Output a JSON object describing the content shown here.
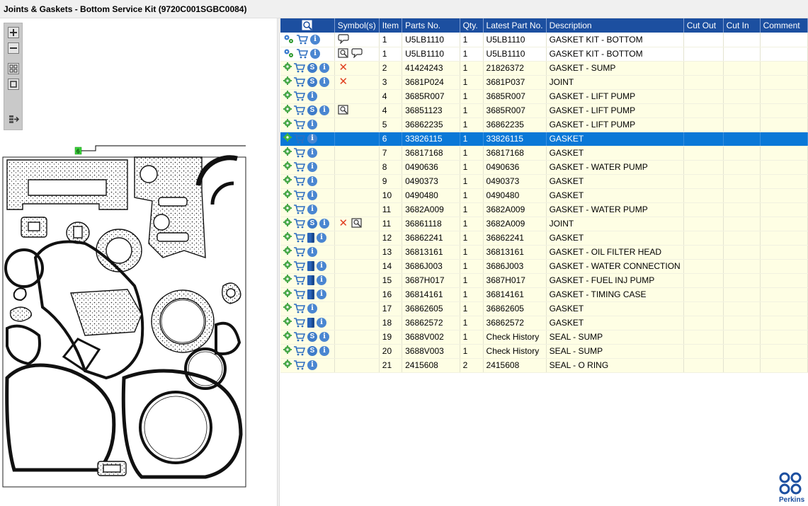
{
  "window": {
    "title": "Joints & Gaskets - Bottom Service Kit (9720C001SGBC0084)"
  },
  "toolbar": {
    "zoom_in": "zoom-in",
    "zoom_out": "zoom-out",
    "fit_page": "fit-page",
    "actual_size": "actual-size",
    "export": "export"
  },
  "drawing": {
    "callout_label": "6"
  },
  "columns": {
    "symbols": "Symbol(s)",
    "item": "Item",
    "parts_no": "Parts No.",
    "qty": "Qty.",
    "latest_part_no": "Latest Part No.",
    "description": "Description",
    "cut_out": "Cut Out",
    "cut_in": "Cut In",
    "comment": "Comment"
  },
  "rows": [
    {
      "item": "1",
      "parts_no": "U5LB1110",
      "qty": "1",
      "latest": "U5LB1110",
      "desc": "GASKET KIT - BOTTOM",
      "style": "white",
      "kit": true,
      "s": false,
      "book": false,
      "sym": [
        "note"
      ]
    },
    {
      "item": "1",
      "parts_no": "U5LB1110",
      "qty": "1",
      "latest": "U5LB1110",
      "desc": "GASKET KIT - BOTTOM",
      "style": "white",
      "kit": true,
      "s": false,
      "book": false,
      "sym": [
        "view",
        "note"
      ]
    },
    {
      "item": "2",
      "parts_no": "41424243",
      "qty": "1",
      "latest": "21826372",
      "desc": "GASKET - SUMP",
      "style": "yellow",
      "kit": false,
      "s": true,
      "book": false,
      "sym": [
        "x"
      ]
    },
    {
      "item": "3",
      "parts_no": "3681P024",
      "qty": "1",
      "latest": "3681P037",
      "desc": "JOINT",
      "style": "yellow",
      "kit": false,
      "s": true,
      "book": false,
      "sym": [
        "x"
      ]
    },
    {
      "item": "4",
      "parts_no": "3685R007",
      "qty": "1",
      "latest": "3685R007",
      "desc": "GASKET - LIFT PUMP",
      "style": "yellow",
      "kit": false,
      "s": false,
      "book": false,
      "sym": []
    },
    {
      "item": "4",
      "parts_no": "36851123",
      "qty": "1",
      "latest": "3685R007",
      "desc": "GASKET - LIFT PUMP",
      "style": "yellow",
      "kit": false,
      "s": true,
      "book": false,
      "sym": [
        "view"
      ]
    },
    {
      "item": "5",
      "parts_no": "36862235",
      "qty": "1",
      "latest": "36862235",
      "desc": "GASKET - LIFT PUMP",
      "style": "yellow",
      "kit": false,
      "s": false,
      "book": false,
      "sym": []
    },
    {
      "item": "6",
      "parts_no": "33826115",
      "qty": "1",
      "latest": "33826115",
      "desc": "GASKET",
      "style": "selected",
      "kit": false,
      "s": false,
      "book": false,
      "sym": []
    },
    {
      "item": "7",
      "parts_no": "36817168",
      "qty": "1",
      "latest": "36817168",
      "desc": "GASKET",
      "style": "yellow",
      "kit": false,
      "s": false,
      "book": false,
      "sym": []
    },
    {
      "item": "8",
      "parts_no": "0490636",
      "qty": "1",
      "latest": "0490636",
      "desc": "GASKET - WATER PUMP",
      "style": "yellow",
      "kit": false,
      "s": false,
      "book": false,
      "sym": []
    },
    {
      "item": "9",
      "parts_no": "0490373",
      "qty": "1",
      "latest": "0490373",
      "desc": "GASKET",
      "style": "yellow",
      "kit": false,
      "s": false,
      "book": false,
      "sym": []
    },
    {
      "item": "10",
      "parts_no": "0490480",
      "qty": "1",
      "latest": "0490480",
      "desc": "GASKET",
      "style": "yellow",
      "kit": false,
      "s": false,
      "book": false,
      "sym": []
    },
    {
      "item": "11",
      "parts_no": "3682A009",
      "qty": "1",
      "latest": "3682A009",
      "desc": "GASKET - WATER PUMP",
      "style": "yellow",
      "kit": false,
      "s": false,
      "book": false,
      "sym": []
    },
    {
      "item": "11",
      "parts_no": "36861118",
      "qty": "1",
      "latest": "3682A009",
      "desc": "JOINT",
      "style": "yellow",
      "kit": false,
      "s": true,
      "book": false,
      "sym": [
        "x",
        "view"
      ]
    },
    {
      "item": "12",
      "parts_no": "36862241",
      "qty": "1",
      "latest": "36862241",
      "desc": "GASKET",
      "style": "yellow",
      "kit": false,
      "s": false,
      "book": true,
      "sym": []
    },
    {
      "item": "13",
      "parts_no": "36813161",
      "qty": "1",
      "latest": "36813161",
      "desc": "GASKET - OIL FILTER HEAD",
      "style": "yellow",
      "kit": false,
      "s": false,
      "book": false,
      "sym": []
    },
    {
      "item": "14",
      "parts_no": "3686J003",
      "qty": "1",
      "latest": "3686J003",
      "desc": "GASKET - WATER CONNECTION",
      "style": "yellow",
      "kit": false,
      "s": false,
      "book": true,
      "sym": []
    },
    {
      "item": "15",
      "parts_no": "3687H017",
      "qty": "1",
      "latest": "3687H017",
      "desc": "GASKET - FUEL INJ PUMP",
      "style": "yellow",
      "kit": false,
      "s": false,
      "book": true,
      "sym": []
    },
    {
      "item": "16",
      "parts_no": "36814161",
      "qty": "1",
      "latest": "36814161",
      "desc": "GASKET - TIMING CASE",
      "style": "yellow",
      "kit": false,
      "s": false,
      "book": true,
      "sym": []
    },
    {
      "item": "17",
      "parts_no": "36862605",
      "qty": "1",
      "latest": "36862605",
      "desc": "GASKET",
      "style": "yellow",
      "kit": false,
      "s": false,
      "book": false,
      "sym": []
    },
    {
      "item": "18",
      "parts_no": "36862572",
      "qty": "1",
      "latest": "36862572",
      "desc": "GASKET",
      "style": "yellow",
      "kit": false,
      "s": false,
      "book": true,
      "sym": []
    },
    {
      "item": "19",
      "parts_no": "3688V002",
      "qty": "1",
      "latest": "Check History",
      "desc": "SEAL - SUMP",
      "style": "yellow",
      "kit": false,
      "s": true,
      "book": false,
      "sym": []
    },
    {
      "item": "20",
      "parts_no": "3688V003",
      "qty": "1",
      "latest": "Check History",
      "desc": "SEAL - SUMP",
      "style": "yellow",
      "kit": false,
      "s": true,
      "book": false,
      "sym": []
    },
    {
      "item": "21",
      "parts_no": "2415608",
      "qty": "2",
      "latest": "2415608",
      "desc": "SEAL - O RING",
      "style": "yellow",
      "kit": false,
      "s": false,
      "book": false,
      "sym": []
    }
  ],
  "brand": {
    "name": "Perkins",
    "color": "#1c4fa0"
  }
}
